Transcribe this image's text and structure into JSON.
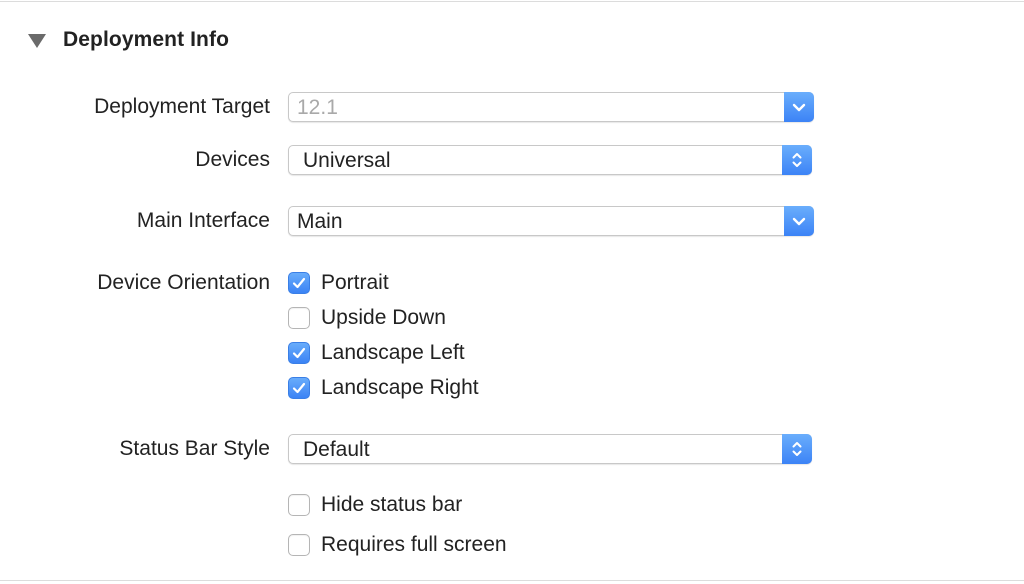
{
  "section": {
    "title": "Deployment Info",
    "expanded": true
  },
  "deployment_target": {
    "label": "Deployment Target",
    "value": "12.1",
    "enabled": false
  },
  "devices": {
    "label": "Devices",
    "value": "Universal"
  },
  "main_interface": {
    "label": "Main Interface",
    "value": "Main"
  },
  "device_orientation": {
    "label": "Device Orientation",
    "options": [
      {
        "label": "Portrait",
        "checked": true
      },
      {
        "label": "Upside Down",
        "checked": false
      },
      {
        "label": "Landscape Left",
        "checked": true
      },
      {
        "label": "Landscape Right",
        "checked": true
      }
    ]
  },
  "status_bar_style": {
    "label": "Status Bar Style",
    "value": "Default"
  },
  "hide_status_bar": {
    "label": "Hide status bar",
    "checked": false
  },
  "requires_full_screen": {
    "label": "Requires full screen",
    "checked": false
  },
  "colors": {
    "accent": "#3c83f6",
    "disabled_text": "#a9a9a9"
  },
  "icons": {
    "disclosure": "disclosure-triangle-down-icon",
    "combo_button": "chevron-down-icon",
    "popup_button": "up-down-chevrons-icon",
    "checkmark": "checkmark-icon"
  }
}
